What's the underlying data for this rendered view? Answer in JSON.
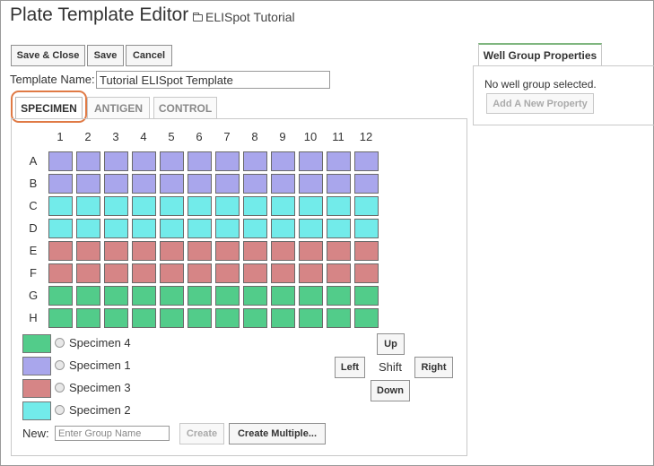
{
  "header": {
    "title": "Plate Template Editor",
    "breadcrumb": "ELISpot Tutorial",
    "breadcrumb_icon": "folder-icon"
  },
  "toolbar": {
    "save_close_label": "Save & Close",
    "save_label": "Save",
    "cancel_label": "Cancel"
  },
  "template": {
    "name_label": "Template Name:",
    "name_value": "Tutorial ELISpot Template"
  },
  "tabs": [
    {
      "label": "SPECIMEN",
      "active": true
    },
    {
      "label": "ANTIGEN",
      "active": false
    },
    {
      "label": "CONTROL",
      "active": false
    }
  ],
  "plate": {
    "columns": [
      "1",
      "2",
      "3",
      "4",
      "5",
      "6",
      "7",
      "8",
      "9",
      "10",
      "11",
      "12"
    ],
    "rows": [
      {
        "label": "A",
        "group": "Specimen 1"
      },
      {
        "label": "B",
        "group": "Specimen 1"
      },
      {
        "label": "C",
        "group": "Specimen 2"
      },
      {
        "label": "D",
        "group": "Specimen 2"
      },
      {
        "label": "E",
        "group": "Specimen 3"
      },
      {
        "label": "F",
        "group": "Specimen 3"
      },
      {
        "label": "G",
        "group": "Specimen 4"
      },
      {
        "label": "H",
        "group": "Specimen 4"
      }
    ]
  },
  "groups": [
    {
      "name": "Specimen 4",
      "color": "#52cc8a"
    },
    {
      "name": "Specimen 1",
      "color": "#a9a6ec"
    },
    {
      "name": "Specimen 3",
      "color": "#d68586"
    },
    {
      "name": "Specimen 2",
      "color": "#72ebea"
    }
  ],
  "new_group": {
    "label": "New:",
    "placeholder": "Enter Group Name",
    "create_label": "Create",
    "create_multiple_label": "Create Multiple..."
  },
  "shift": {
    "label": "Shift",
    "up": "Up",
    "down": "Down",
    "left": "Left",
    "right": "Right"
  },
  "properties": {
    "tab_label": "Well Group Properties",
    "empty_text": "No well group selected.",
    "add_property_label": "Add A New Property"
  }
}
